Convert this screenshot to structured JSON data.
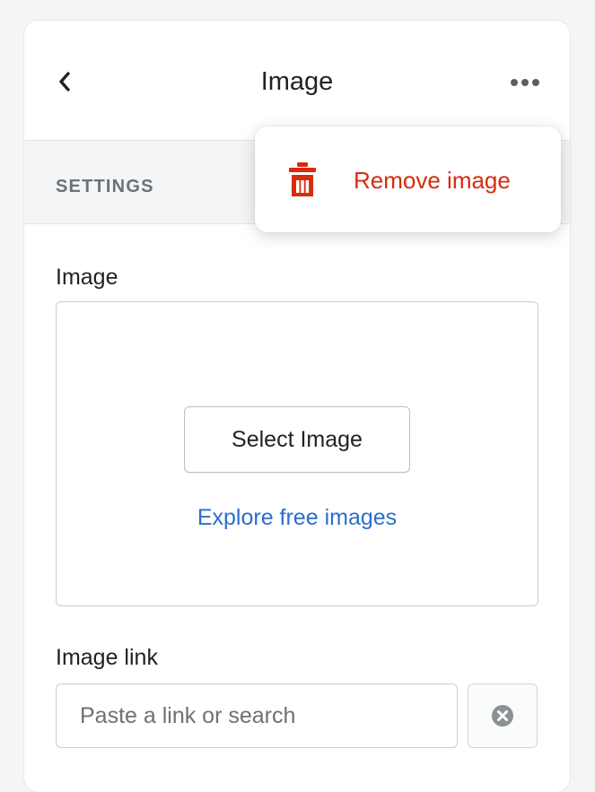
{
  "header": {
    "title": "Image",
    "back_icon": "chevron-left-icon",
    "more_icon": "horizontal-dots-icon"
  },
  "settings": {
    "section_label": "SETTINGS"
  },
  "image_field": {
    "label": "Image",
    "select_button": "Select Image",
    "explore_link": "Explore free images"
  },
  "image_link_field": {
    "label": "Image link",
    "value": "",
    "placeholder": "Paste a link or search",
    "clear_icon": "clear-circle-icon"
  },
  "popover": {
    "remove_label": "Remove image",
    "remove_icon": "trash-icon"
  },
  "colors": {
    "destructive": "#d72c0d",
    "link": "#2c6ecb",
    "text": "#202223",
    "subdued": "#6d7175"
  }
}
